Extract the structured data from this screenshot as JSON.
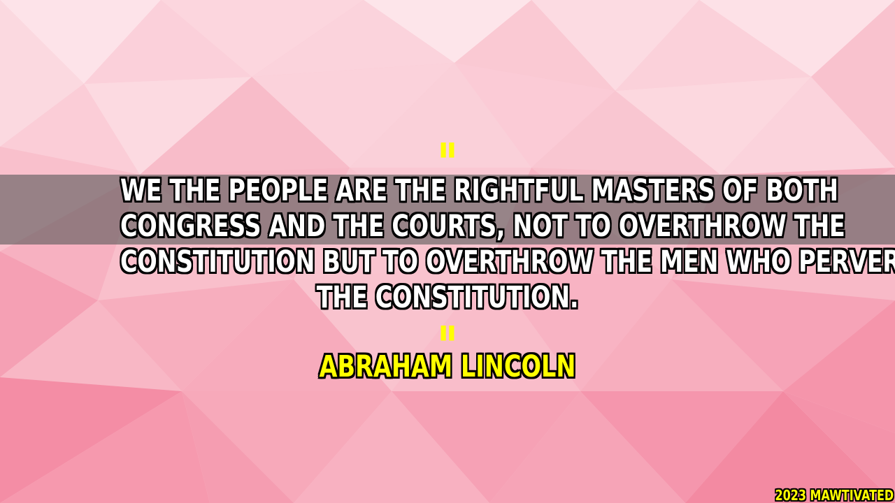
{
  "quote": {
    "open_mark": "\"",
    "lines": [
      "WE THE PEOPLE ARE THE RIGHTFUL MASTERS OF BOTH",
      "CONGRESS AND THE COURTS, NOT TO OVERTHROW THE",
      "CONSTITUTION BUT TO OVERTHROW THE MEN WHO PERVERT",
      "THE CONSTITUTION."
    ],
    "close_mark": "\""
  },
  "author": "ABRAHAM LINCOLN",
  "watermark": "2023 MAWTIVATED",
  "colors": {
    "background_light": "#fde0e6",
    "background_mid": "#f9b8c6",
    "background_deep": "#f48ca3",
    "band": "#5a5a5a",
    "quote_text": "#ffffff",
    "accent_yellow": "#ffff00",
    "outline": "#000000"
  }
}
